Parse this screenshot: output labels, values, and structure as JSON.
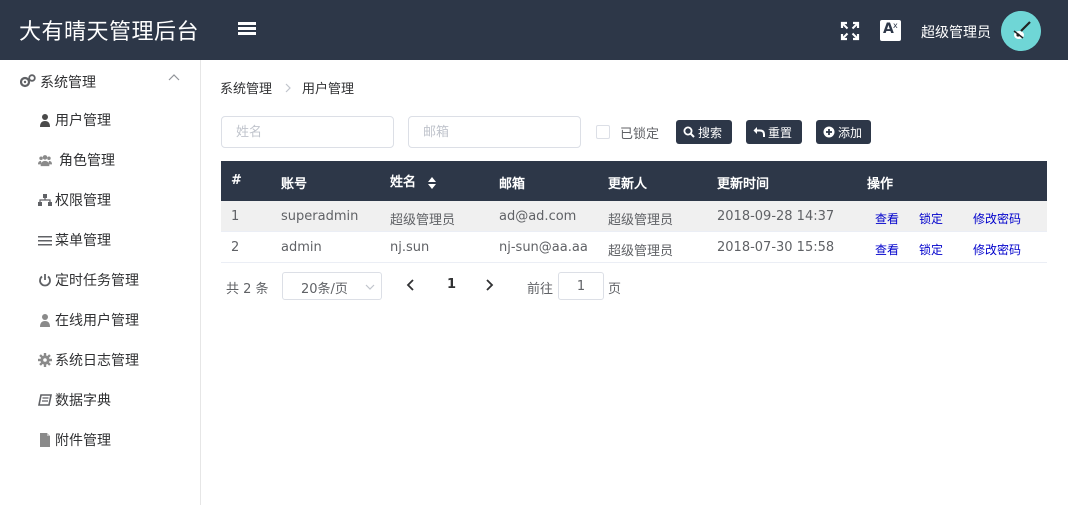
{
  "header": {
    "title": "大有晴天管理后台",
    "user_name": "超级管理员",
    "translate_letter": "A",
    "translate_sub": "x"
  },
  "sidebar": {
    "group_label": "系统管理",
    "items": [
      {
        "label": "用户管理",
        "icon": "user-icon"
      },
      {
        "label": "角色管理",
        "icon": "users-icon"
      },
      {
        "label": "权限管理",
        "icon": "sitemap-icon"
      },
      {
        "label": "菜单管理",
        "icon": "list-icon"
      },
      {
        "label": "定时任务管理",
        "icon": "power-icon"
      },
      {
        "label": "在线用户管理",
        "icon": "user-icon"
      },
      {
        "label": "系统日志管理",
        "icon": "gear-icon"
      },
      {
        "label": "数据字典",
        "icon": "book-icon"
      },
      {
        "label": "附件管理",
        "icon": "file-icon"
      }
    ]
  },
  "breadcrumb": {
    "root": "系统管理",
    "current": "用户管理"
  },
  "search": {
    "name_placeholder": "姓名",
    "email_placeholder": "邮箱",
    "locked_label": "已锁定",
    "search_label": "搜索",
    "reset_label": "重置",
    "add_label": "添加"
  },
  "table": {
    "headers": {
      "index": "#",
      "account": "账号",
      "name": "姓名",
      "email": "邮箱",
      "updater": "更新人",
      "updated_at": "更新时间",
      "actions": "操作"
    },
    "rows": [
      {
        "index": "1",
        "account": "superadmin",
        "name": "超级管理员",
        "email": "ad@ad.com",
        "updater": "超级管理员",
        "updated_at": "2018-09-28 14:37"
      },
      {
        "index": "2",
        "account": "admin",
        "name": "nj.sun",
        "email": "nj-sun@aa.aa",
        "updater": "超级管理员",
        "updated_at": "2018-07-30 15:58"
      }
    ],
    "actions": {
      "view": "查看",
      "lock": "锁定",
      "change_password": "修改密码"
    }
  },
  "pagination": {
    "total_text": "共 2 条",
    "page_size": "20条/页",
    "current_page": "1",
    "goto_label": "前往",
    "goto_value": "1",
    "goto_suffix": "页"
  },
  "colors": {
    "header_bg": "#2d3748",
    "link": "#0000cc",
    "avatar_bg": "#6fd6d6"
  }
}
